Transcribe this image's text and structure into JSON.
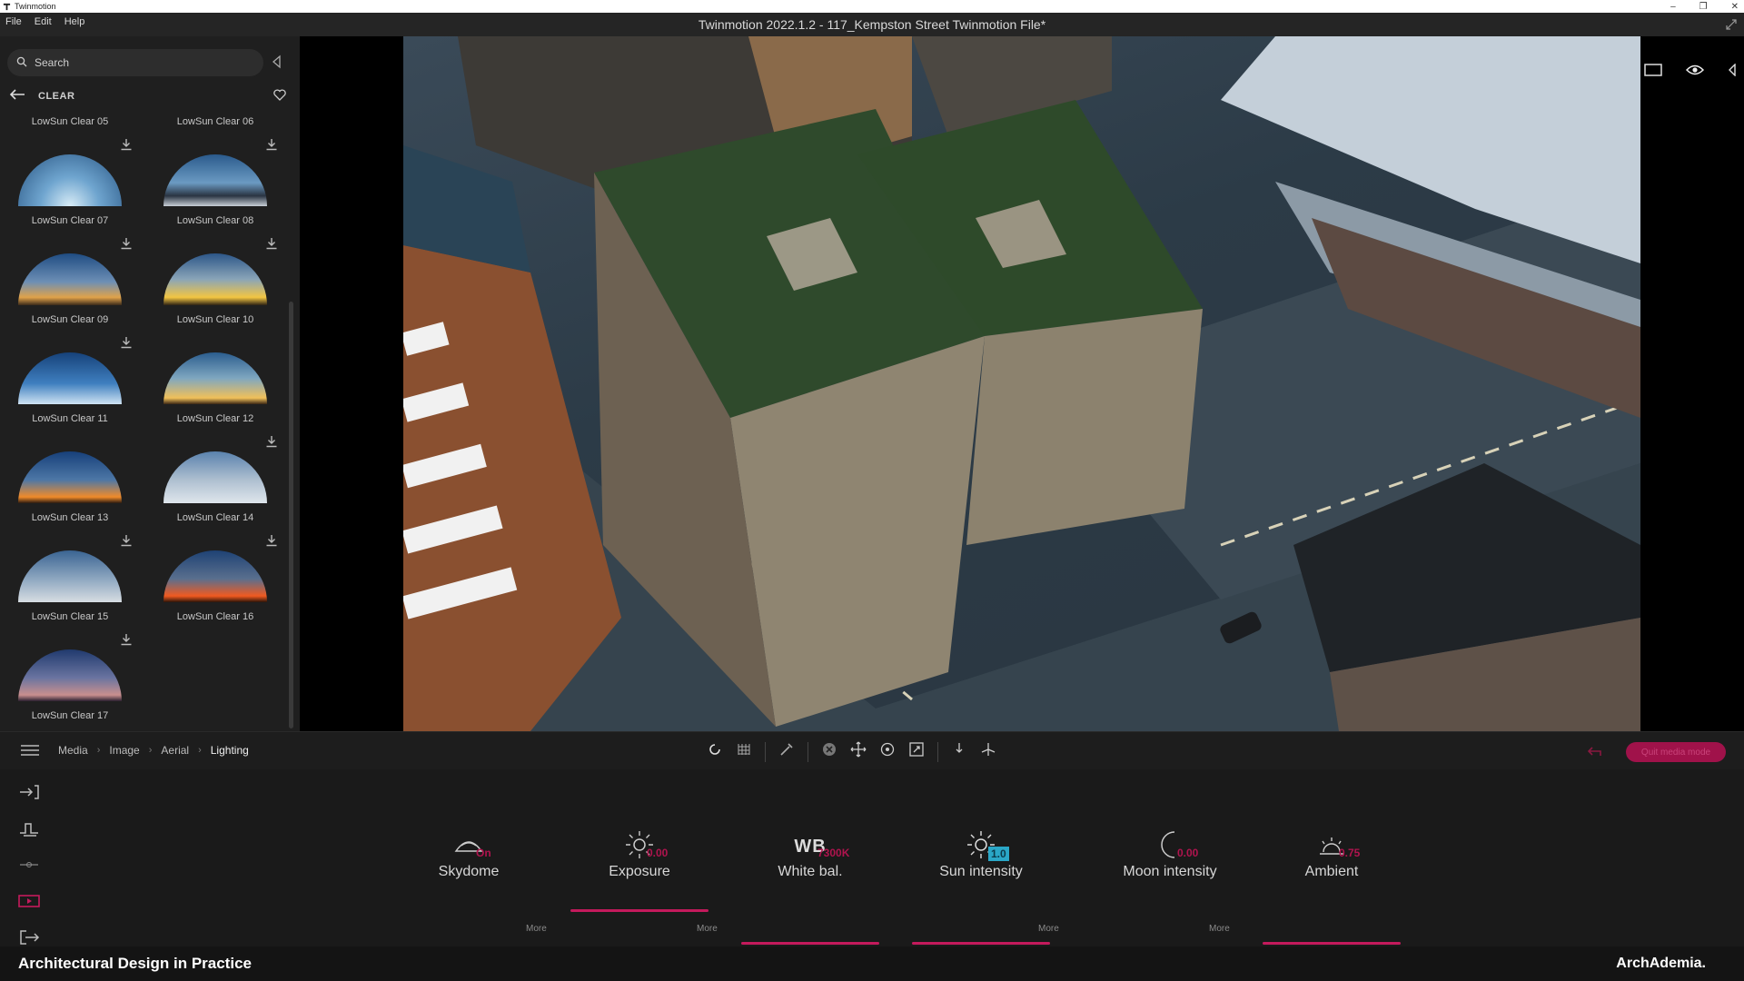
{
  "os": {
    "app_name": "Twinmotion",
    "minimize": "–",
    "restore": "❐",
    "close": "✕"
  },
  "menu": {
    "items": [
      "File",
      "Edit",
      "Help"
    ],
    "title": "Twinmotion 2022.1.2 - 117_Kempston Street Twinmotion File*"
  },
  "library": {
    "search_placeholder": "Search",
    "category": "CLEAR",
    "items": [
      {
        "label": "LowSun Clear 05",
        "download": true,
        "sky": "clear-midday"
      },
      {
        "label": "LowSun Clear 06",
        "download": true,
        "sky": "clear-dusk-clouds"
      },
      {
        "label": "LowSun Clear 07",
        "download": true,
        "sky": "sunset-low"
      },
      {
        "label": "LowSun Clear 08",
        "download": true,
        "sky": "sunset-golden"
      },
      {
        "label": "LowSun Clear 09",
        "download": true,
        "sky": "clear-blue"
      },
      {
        "label": "LowSun Clear 10",
        "download": false,
        "sky": "sunset-warm"
      },
      {
        "label": "LowSun Clear 11",
        "download": false,
        "sky": "sunset-orange"
      },
      {
        "label": "LowSun Clear 12",
        "download": true,
        "sky": "hazy-clouds"
      },
      {
        "label": "LowSun Clear 13",
        "download": true,
        "sky": "clouds-soft"
      },
      {
        "label": "LowSun Clear 14",
        "download": true,
        "sky": "sunset-red"
      },
      {
        "label": "LowSun Clear 15",
        "download": true,
        "sky": "dusk-purple"
      },
      {
        "label": "LowSun Clear 16",
        "download": false,
        "sky": ""
      },
      {
        "label": "LowSun Clear 17",
        "download": false,
        "sky": ""
      }
    ]
  },
  "breadcrumb": [
    "Media",
    "Image",
    "Aerial",
    "Lighting"
  ],
  "toolbar": {
    "quit_label": "Quit media mode"
  },
  "controls": [
    {
      "name": "Skydome",
      "value": "On",
      "icon": "skydome-icon",
      "bar": "none"
    },
    {
      "name": "Exposure",
      "value": "0.00",
      "icon": "exposure-sun-icon",
      "bar": "top"
    },
    {
      "name": "White bal.",
      "value": "7300K",
      "icon": "wb-icon",
      "icon_text": "WB",
      "bar": "bottom"
    },
    {
      "name": "Sun intensity",
      "value": "1.0",
      "icon": "sun-icon",
      "bar": "bottom"
    },
    {
      "name": "Moon intensity",
      "value": "0.00",
      "icon": "moon-icon",
      "bar": "below"
    },
    {
      "name": "Ambient",
      "value": "0.75",
      "icon": "ambient-icon",
      "bar": "bottom"
    }
  ],
  "more_label": "More",
  "footer": {
    "left": "Architectural Design in Practice",
    "right": "ArchAdemia."
  },
  "colors": {
    "accent": "#c41a5c",
    "panel": "#1f1f1f",
    "bg": "#141414"
  }
}
